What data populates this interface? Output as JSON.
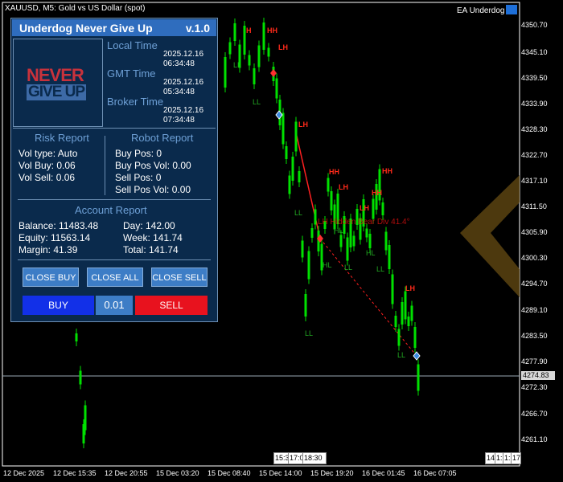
{
  "header": {
    "symbol_info": "XAUUSD, M5:  Gold vs US Dollar (spot)",
    "ea_name": "EA Underdog"
  },
  "colors": {
    "bull_candle": "#00e000",
    "swing_high": "#ff2a1a",
    "swing_low": "#22aa22",
    "panel_bg": "#0a2a4c",
    "panel_title": "#2f6dbe"
  },
  "price_axis": [
    "4350.70",
    "4345.10",
    "4339.50",
    "4333.90",
    "4328.30",
    "4322.70",
    "4317.10",
    "4311.50",
    "4305.90",
    "4300.30",
    "4294.70",
    "4289.10",
    "4283.50",
    "4277.90",
    "4272.30",
    "4266.70",
    "4261.10"
  ],
  "current_price": "4274.83",
  "time_axis": [
    "12 Dec 2025",
    "12 Dec 15:35",
    "12 Dec 20:55",
    "15 Dec 03:20",
    "15 Dec 08:40",
    "15 Dec 14:00",
    "15 Dec 19:20",
    "16 Dec 01:45",
    "16 Dec 07:05"
  ],
  "time_boxes": [
    "15:3",
    "17:0",
    "18:30",
    "14",
    "1:",
    "1:",
    "17"
  ],
  "annotations": [
    "H",
    "HH",
    "LH",
    "LL",
    "LL",
    "LH",
    "HH",
    "LH",
    "HH",
    "LL",
    "HL",
    "LH",
    "HL",
    "HL",
    "LL",
    "LL",
    "LL",
    "LH",
    "LL",
    "HH"
  ],
  "pattern_text": "LH Hidden Bear Div 41.4°",
  "panel": {
    "title": "Underdog Never Give Up",
    "version": "v.1.0",
    "logo_line1": "NEVER",
    "logo_line2": "GIVE UP",
    "local_time_label": "Local Time",
    "local_time_value": "2025.12.16 06:34:48",
    "gmt_time_label": "GMT Time",
    "gmt_time_value": "2025.12.16 05:34:48",
    "broker_time_label": "Broker Time",
    "broker_time_value": "2025.12.16 07:34:48",
    "risk_title": "Risk Report",
    "risk_rows": [
      "Vol type:  Auto",
      "Vol Buy:   0.06",
      "Vol Sell:  0.06"
    ],
    "robot_title": "Robot Report",
    "robot_rows": [
      "Buy Pos: 0",
      "Buy Pos Vol: 0.00",
      "Sell Pos: 0",
      "Sell Pos Vol: 0.00"
    ],
    "account_title": "Account Report",
    "account_left": [
      "Balance: 11483.48",
      "Equity:     11563.14",
      "Margin:    41.39"
    ],
    "account_right": [
      "Day:     142.00",
      "Week:  141.74",
      "Total:   141.74"
    ],
    "close_buy": "CLOSE BUY",
    "close_all": "CLOSE ALL",
    "close_sell": "CLOSE SELL",
    "buy": "BUY",
    "lot": "0.01",
    "sell": "SELL"
  }
}
